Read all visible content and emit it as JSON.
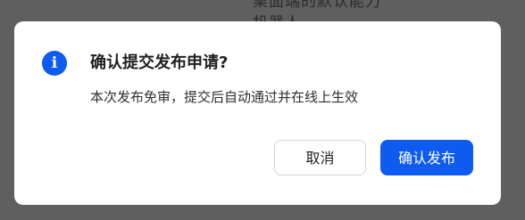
{
  "background": {
    "lines": [
      "桌面端的默认能力",
      "机器人"
    ]
  },
  "dialog": {
    "icon": "info-icon",
    "icon_glyph": "i",
    "title": "确认提交发布申请?",
    "description": "本次发布免审，提交后自动通过并在线上生效",
    "cancel_label": "取消",
    "confirm_label": "确认发布",
    "accent_color": "#0e5bf0"
  }
}
